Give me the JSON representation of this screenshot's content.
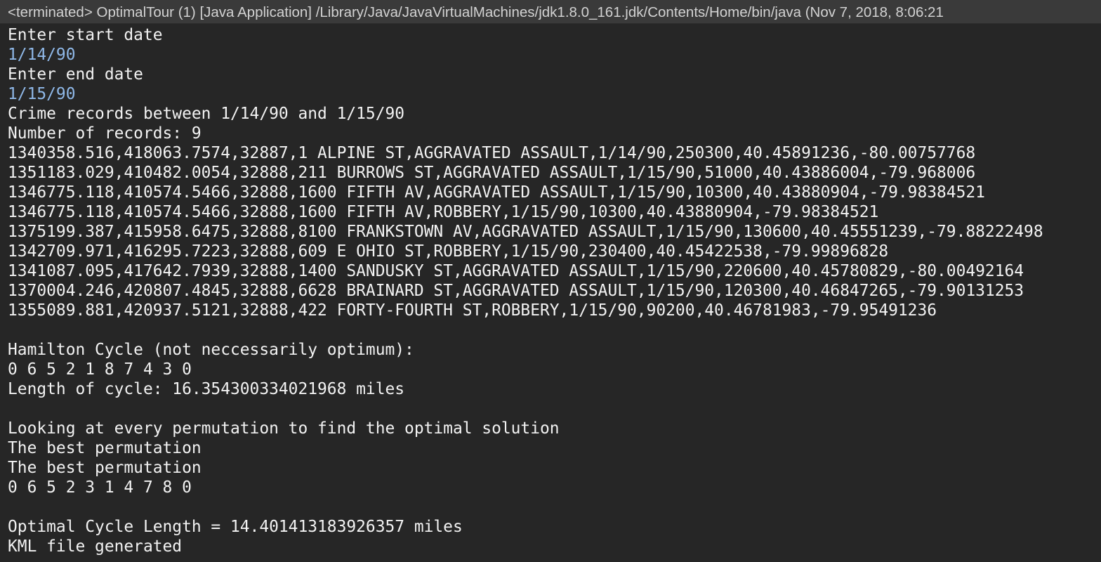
{
  "window": {
    "title": "<terminated> OptimalTour (1) [Java Application] /Library/Java/JavaVirtualMachines/jdk1.8.0_161.jdk/Contents/Home/bin/java (Nov 7, 2018, 8:06:21"
  },
  "console": {
    "lines": [
      {
        "text": "Enter start date",
        "type": "output"
      },
      {
        "text": "1/14/90",
        "type": "input"
      },
      {
        "text": "Enter end date",
        "type": "output"
      },
      {
        "text": "1/15/90",
        "type": "input"
      },
      {
        "text": "Crime records between 1/14/90 and 1/15/90",
        "type": "output"
      },
      {
        "text": "Number of records: 9",
        "type": "output"
      },
      {
        "text": "1340358.516,418063.7574,32887,1 ALPINE ST,AGGRAVATED ASSAULT,1/14/90,250300,40.45891236,-80.00757768",
        "type": "output"
      },
      {
        "text": "1351183.029,410482.0054,32888,211 BURROWS ST,AGGRAVATED ASSAULT,1/15/90,51000,40.43886004,-79.968006",
        "type": "output"
      },
      {
        "text": "1346775.118,410574.5466,32888,1600 FIFTH AV,AGGRAVATED ASSAULT,1/15/90,10300,40.43880904,-79.98384521",
        "type": "output"
      },
      {
        "text": "1346775.118,410574.5466,32888,1600 FIFTH AV,ROBBERY,1/15/90,10300,40.43880904,-79.98384521",
        "type": "output"
      },
      {
        "text": "1375199.387,415958.6475,32888,8100 FRANKSTOWN AV,AGGRAVATED ASSAULT,1/15/90,130600,40.45551239,-79.88222498",
        "type": "output"
      },
      {
        "text": "1342709.971,416295.7223,32888,609 E OHIO ST,ROBBERY,1/15/90,230400,40.45422538,-79.99896828",
        "type": "output"
      },
      {
        "text": "1341087.095,417642.7939,32888,1400 SANDUSKY ST,AGGRAVATED ASSAULT,1/15/90,220600,40.45780829,-80.00492164",
        "type": "output"
      },
      {
        "text": "1370004.246,420807.4845,32888,6628 BRAINARD ST,AGGRAVATED ASSAULT,1/15/90,120300,40.46847265,-79.90131253",
        "type": "output"
      },
      {
        "text": "1355089.881,420937.5121,32888,422 FORTY-FOURTH ST,ROBBERY,1/15/90,90200,40.46781983,-79.95491236",
        "type": "output"
      },
      {
        "text": "",
        "type": "output"
      },
      {
        "text": "Hamilton Cycle (not neccessarily optimum):",
        "type": "output"
      },
      {
        "text": "0 6 5 2 1 8 7 4 3 0",
        "type": "output"
      },
      {
        "text": "Length of cycle: 16.354300334021968 miles",
        "type": "output"
      },
      {
        "text": "",
        "type": "output"
      },
      {
        "text": "Looking at every permutation to find the optimal solution",
        "type": "output"
      },
      {
        "text": "The best permutation",
        "type": "output"
      },
      {
        "text": "The best permutation",
        "type": "output"
      },
      {
        "text": "0 6 5 2 3 1 4 7 8 0",
        "type": "output"
      },
      {
        "text": "",
        "type": "output"
      },
      {
        "text": "Optimal Cycle Length = 14.401413183926357 miles",
        "type": "output"
      },
      {
        "text": "KML file generated",
        "type": "output"
      }
    ]
  },
  "colors": {
    "background": "#262626",
    "header_background": "#3a3a3a",
    "output_text": "#f2f2f2",
    "input_text": "#8fb8e8"
  }
}
